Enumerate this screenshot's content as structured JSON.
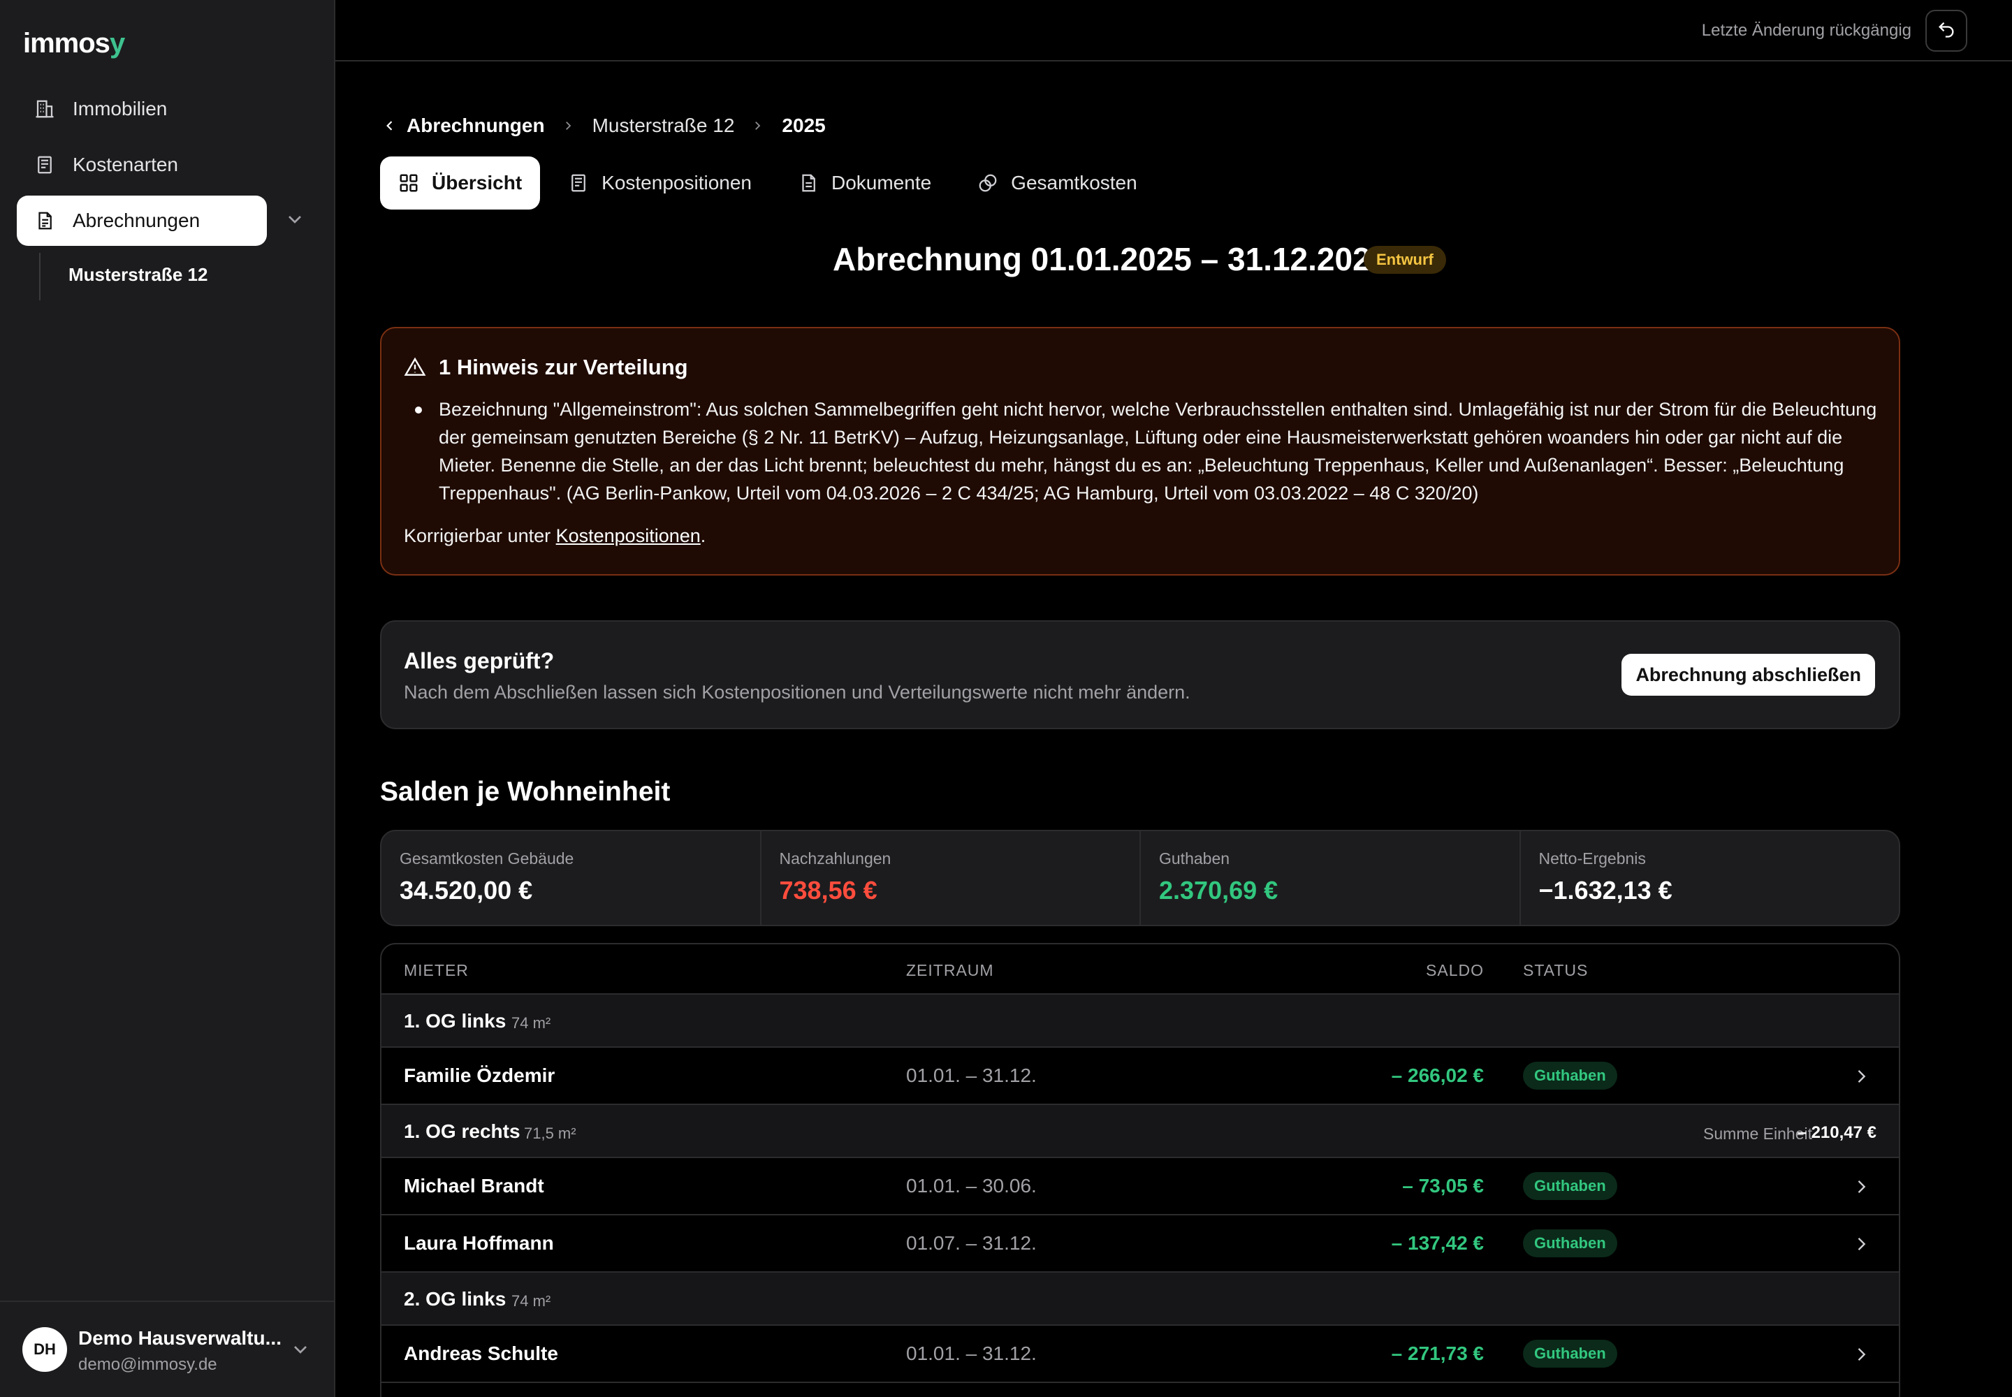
{
  "app": {
    "logo_main": "immos",
    "logo_accent": "y",
    "accent_color": "#3ec28f"
  },
  "sidebar": {
    "items": [
      {
        "label": "Immobilien",
        "icon": "building-icon"
      },
      {
        "label": "Kostenarten",
        "icon": "receipt-icon"
      },
      {
        "label": "Abrechnungen",
        "icon": "document-icon",
        "active": true
      }
    ],
    "sub_items": [
      {
        "label": "Musterstraße 12"
      }
    ],
    "footer": {
      "initials": "DH",
      "org_name": "Demo Hausverwaltu...",
      "email": "demo@immosy.de"
    }
  },
  "topbar": {
    "undo_label": "Letzte Änderung rückgängig"
  },
  "breadcrumb": {
    "back": "Abrechnungen",
    "property": "Musterstraße 12",
    "year": "2025"
  },
  "tabs": [
    {
      "label": "Übersicht",
      "icon": "grid-icon",
      "active": true
    },
    {
      "label": "Kostenpositionen",
      "icon": "receipt-icon"
    },
    {
      "label": "Dokumente",
      "icon": "file-icon"
    },
    {
      "label": "Gesamtkosten",
      "icon": "coins-icon"
    }
  ],
  "header": {
    "title": "Abrechnung 01.01.2025 – 31.12.2025",
    "status_badge": "Entwurf"
  },
  "warning": {
    "title": "1 Hinweis zur Verteilung",
    "items": [
      "Bezeichnung \"Allgemeinstrom\": Aus solchen Sammelbegriffen geht nicht hervor, welche Verbrauchsstellen enthalten sind. Umlagefähig ist nur der Strom für die Beleuchtung der gemeinsam genutzten Bereiche (§ 2 Nr. 11 BetrKV) – Aufzug, Heizungsanlage, Lüftung oder eine Hausmeisterwerkstatt gehören woanders hin oder gar nicht auf die Mieter. Benenne die Stelle, an der das Licht brennt; beleuchtest du mehr, hängst du es an: „Beleuchtung Treppenhaus, Keller und Außenanlagen“. Besser: „Beleuchtung Treppenhaus\". (AG Berlin-Pankow, Urteil vom 04.03.2026 – 2 C 434/25; AG Hamburg, Urteil vom 03.03.2022 – 48 C 320/20)"
    ],
    "footer_prefix": "Korrigierbar unter ",
    "footer_link": "Kostenpositionen",
    "footer_suffix": "."
  },
  "confirm": {
    "title": "Alles geprüft?",
    "subtitle": "Nach dem Abschließen lassen sich Kostenpositionen und Verteilungswerte nicht mehr ändern.",
    "button": "Abrechnung abschließen"
  },
  "balances": {
    "title": "Salden je Wohneinheit",
    "stats": [
      {
        "label": "Gesamtkosten Gebäude",
        "value": "34.520,00 €",
        "color": "#ffffff"
      },
      {
        "label": "Nachzahlungen",
        "value": "738,56 €",
        "color": "#ff4d3d"
      },
      {
        "label": "Guthaben",
        "value": "2.370,69 €",
        "color": "#32c77f"
      },
      {
        "label": "Netto-Ergebnis",
        "value": "−1.632,13 €",
        "color": "#ffffff"
      }
    ],
    "columns": {
      "tenant": "MIETER",
      "period": "ZEITRAUM",
      "balance": "SALDO",
      "status": "STATUS"
    },
    "groups": [
      {
        "unit": "1. OG links",
        "area": "74 m²",
        "sum_label": "",
        "sum_value": "",
        "tenants": [
          {
            "name": "Familie Özdemir",
            "period": "01.01. – 31.12.",
            "saldo": "– 266,02 €",
            "status": "Guthaben"
          }
        ]
      },
      {
        "unit": "1. OG rechts",
        "area": "71,5 m²",
        "sum_label": "Summe Einheit",
        "sum_value": "– 210,47 €",
        "tenants": [
          {
            "name": "Michael Brandt",
            "period": "01.01. – 30.06.",
            "saldo": "– 73,05 €",
            "status": "Guthaben"
          },
          {
            "name": "Laura Hoffmann",
            "period": "01.07. – 31.12.",
            "saldo": "– 137,42 €",
            "status": "Guthaben"
          }
        ]
      },
      {
        "unit": "2. OG links",
        "area": "74 m²",
        "sum_label": "",
        "sum_value": "",
        "tenants": [
          {
            "name": "Andreas Schulte",
            "period": "01.01. – 31.12.",
            "saldo": "– 271,73 €",
            "status": "Guthaben"
          }
        ]
      }
    ]
  }
}
